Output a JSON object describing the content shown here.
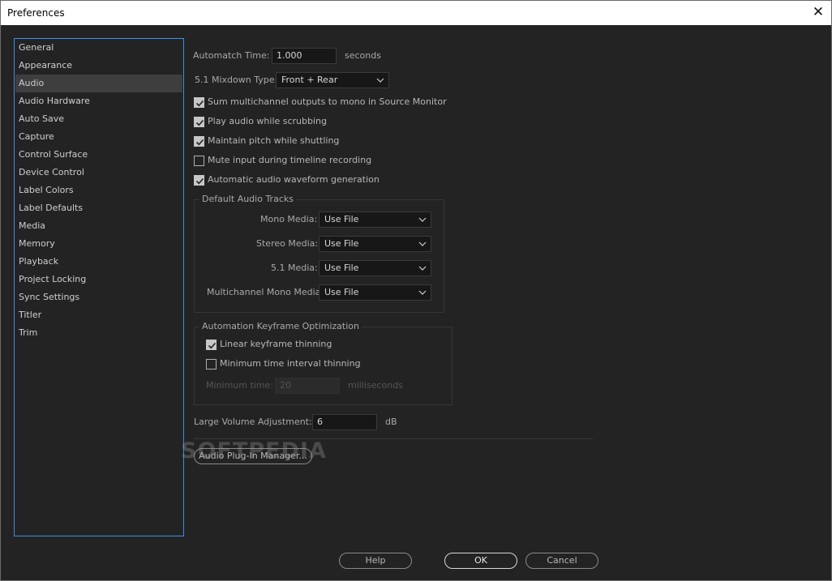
{
  "window": {
    "title": "Preferences"
  },
  "sidebar": {
    "items": [
      {
        "label": "General"
      },
      {
        "label": "Appearance"
      },
      {
        "label": "Audio",
        "selected": true
      },
      {
        "label": "Audio Hardware"
      },
      {
        "label": "Auto Save"
      },
      {
        "label": "Capture"
      },
      {
        "label": "Control Surface"
      },
      {
        "label": "Device Control"
      },
      {
        "label": "Label Colors"
      },
      {
        "label": "Label Defaults"
      },
      {
        "label": "Media"
      },
      {
        "label": "Memory"
      },
      {
        "label": "Playback"
      },
      {
        "label": "Project Locking"
      },
      {
        "label": "Sync Settings"
      },
      {
        "label": "Titler"
      },
      {
        "label": "Trim"
      }
    ]
  },
  "audio": {
    "automatch": {
      "label": "Automatch Time:",
      "value": "1.000",
      "unit": "seconds"
    },
    "mixdown": {
      "label": "5.1 Mixdown Type:",
      "value": "Front + Rear"
    },
    "checkboxes": [
      {
        "label": "Sum multichannel outputs to mono in Source Monitor",
        "checked": true
      },
      {
        "label": "Play audio while scrubbing",
        "checked": true
      },
      {
        "label": "Maintain pitch while shuttling",
        "checked": true
      },
      {
        "label": "Mute input during timeline recording",
        "checked": false
      },
      {
        "label": "Automatic audio waveform generation",
        "checked": true
      }
    ],
    "default_tracks": {
      "title": "Default Audio Tracks",
      "rows": [
        {
          "label": "Mono Media:",
          "value": "Use File"
        },
        {
          "label": "Stereo Media:",
          "value": "Use File"
        },
        {
          "label": "5.1 Media:",
          "value": "Use File"
        },
        {
          "label": "Multichannel Mono Media:",
          "value": "Use File"
        }
      ]
    },
    "keyframe": {
      "title": "Automation Keyframe Optimization",
      "linear": {
        "label": "Linear keyframe thinning",
        "checked": true
      },
      "min_interval": {
        "label": "Minimum time interval thinning",
        "checked": false
      },
      "min_time": {
        "label": "Minimum time:",
        "value": "20",
        "unit": "milliseconds"
      }
    },
    "large_volume": {
      "label": "Large Volume Adjustment:",
      "value": "6",
      "unit": "dB"
    },
    "plugin_manager": "Audio Plug-In Manager..."
  },
  "footer": {
    "help": "Help",
    "ok": "OK",
    "cancel": "Cancel"
  },
  "watermark": "SOFTPEDIA",
  "colors": {
    "accent": "#3c8fe6",
    "background": "#232323"
  }
}
